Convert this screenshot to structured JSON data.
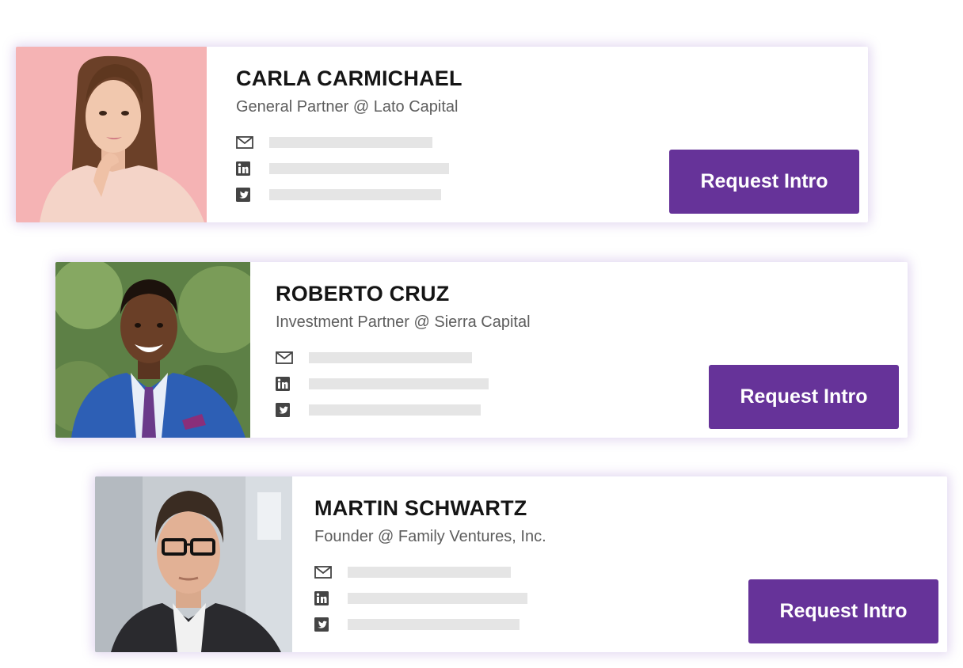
{
  "colors": {
    "accent": "#663399",
    "placeholder_bar": "#e5e5e5",
    "name_text": "#151515",
    "title_text": "#5d5d5d",
    "icon": "#444444"
  },
  "icons": [
    "email-icon",
    "linkedin-icon",
    "twitter-icon"
  ],
  "cards": [
    {
      "name": "CARLA CARMICHAEL",
      "title": "General Partner @ Lato Capital",
      "button_label": "Request Intro",
      "photo": "portrait-woman-pink-background"
    },
    {
      "name": "ROBERTO CRUZ",
      "title": "Investment Partner @ Sierra Capital",
      "button_label": "Request Intro",
      "photo": "portrait-man-blue-suit-green-background"
    },
    {
      "name": "MARTIN SCHWARTZ",
      "title": "Founder @ Family Ventures, Inc.",
      "button_label": "Request Intro",
      "photo": "portrait-man-glasses-gray-background"
    }
  ]
}
